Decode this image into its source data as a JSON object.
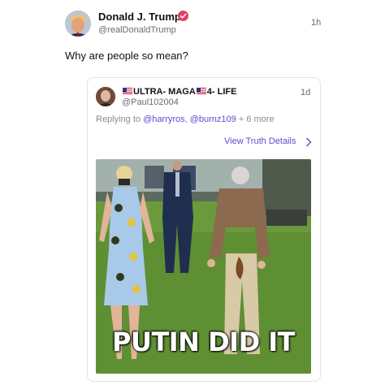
{
  "post": {
    "author_name": "Donald J. Trump",
    "handle": "@realDonaldTrump",
    "timestamp": "1h",
    "text": "Why are people so mean?"
  },
  "quoted": {
    "name_part1": "ULTRA- MAGA",
    "name_part2": "4- LIFE",
    "handle": "@Paul102004",
    "timestamp": "1d",
    "reply_prefix": "Replying to ",
    "reply_user1": "@harryros",
    "reply_sep": ", ",
    "reply_user2": "@burnz109",
    "reply_suffix": " + 6 more",
    "view_details": "View Truth Details",
    "image_caption": "PUTIN DID IT"
  },
  "colors": {
    "accent": "#5a4fcf",
    "verified": "#e4405f",
    "muted": "#6b6b73"
  }
}
